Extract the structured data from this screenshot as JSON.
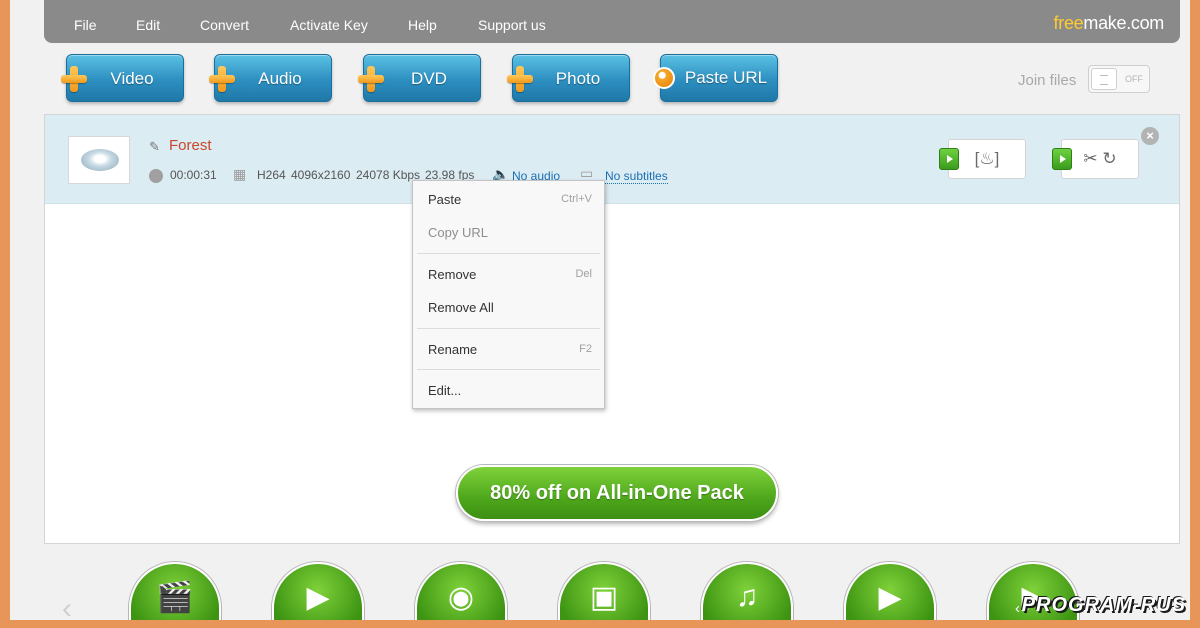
{
  "menu": {
    "items": [
      "File",
      "Edit",
      "Convert",
      "Activate Key",
      "Help",
      "Support us"
    ],
    "brand_prefix": "free",
    "brand_suffix": "make.com"
  },
  "toolbar": {
    "video": "Video",
    "audio": "Audio",
    "dvd": "DVD",
    "photo": "Photo",
    "paste_url": "Paste URL",
    "join_files": "Join files",
    "toggle_state": "OFF"
  },
  "file": {
    "name": "Forest",
    "duration": "00:00:31",
    "codec": "H264",
    "resolution": "4096x2160",
    "bitrate": "24078 Kbps",
    "fps": "23.98 fps",
    "audio": "No audio",
    "subtitles": "No subtitles"
  },
  "context_menu": {
    "paste": "Paste",
    "paste_shortcut": "Ctrl+V",
    "copy_url": "Copy URL",
    "remove": "Remove",
    "remove_shortcut": "Del",
    "remove_all": "Remove All",
    "rename": "Rename",
    "rename_shortcut": "F2",
    "edit": "Edit..."
  },
  "promo": "80% off on All-in-One Pack",
  "watermark": "PROGRAM-RUS",
  "colors": {
    "accent_blue": "#2c8fc0",
    "accent_green": "#4ea71c",
    "file_name": "#c9472b",
    "link": "#1b6fb3",
    "frame": "#e8955a"
  }
}
